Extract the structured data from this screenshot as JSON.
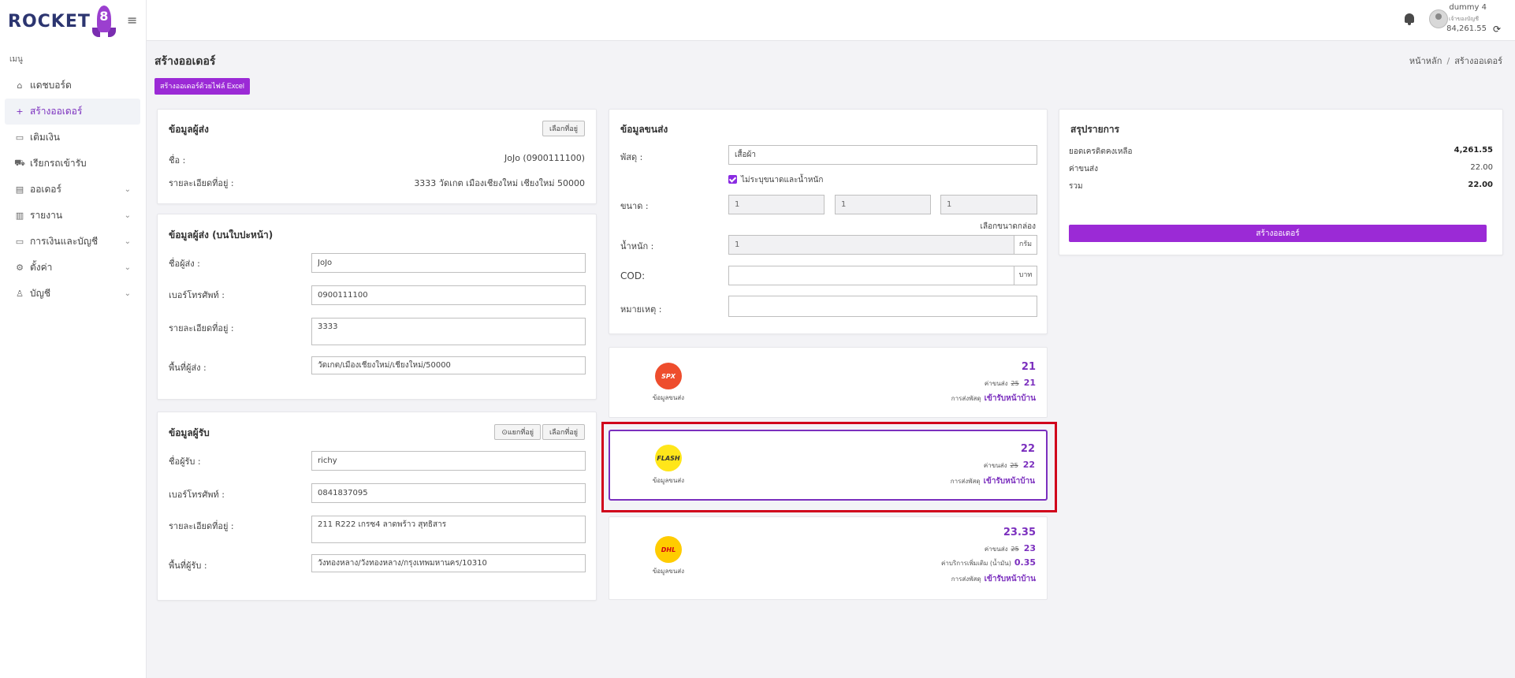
{
  "brand": {
    "logo_text": "ROCKET",
    "logo_digit": "8"
  },
  "sidebar": {
    "menu_title": "เมนู",
    "items": [
      {
        "label": "แดชบอร์ด",
        "icon": "home-icon",
        "glyph": "⌂"
      },
      {
        "label": "สร้างออเดอร์",
        "icon": "plus-icon",
        "glyph": "+"
      },
      {
        "label": "เติมเงิน",
        "icon": "money-icon",
        "glyph": "▭"
      },
      {
        "label": "เรียกรถเข้ารับ",
        "icon": "truck-icon",
        "glyph": "⛟"
      },
      {
        "label": "ออเดอร์",
        "icon": "order-icon",
        "glyph": "▤"
      },
      {
        "label": "รายงาน",
        "icon": "report-icon",
        "glyph": "▥"
      },
      {
        "label": "การเงินและบัญชี",
        "icon": "wallet-icon",
        "glyph": "▭"
      },
      {
        "label": "ตั้งค่า",
        "icon": "gear-icon",
        "glyph": "⚙"
      },
      {
        "label": "บัญชี",
        "icon": "user-icon",
        "glyph": "♙"
      }
    ]
  },
  "header": {
    "user_name": "dummy 4",
    "user_sub": "เจ้าของบัญชี",
    "credit": "84,261.55"
  },
  "page": {
    "title": "สร้างออเดอร์",
    "breadcrumb_home": "หน้าหลัก",
    "breadcrumb_sep": "/",
    "breadcrumb_current": "สร้างออเดอร์",
    "excel_button": "สร้างออเดอร์ด้วยไฟล์ Excel"
  },
  "sender": {
    "title": "ข้อมูลผู้ส่ง",
    "choose_btn": "เลือกที่อยู่",
    "name_label": "ชื่อ :",
    "name_value": "JoJo (0900111100)",
    "address_label": "รายละเอียดที่อยู่ :",
    "address_value": "3333 วัดเกต เมืองเชียงใหม่ เชียงใหม่ 50000"
  },
  "sender_label": {
    "title": "ข้อมูลผู้ส่ง (บนใบปะหน้า)",
    "name_label": "ชื่อผู้ส่ง :",
    "name_value": "JoJo",
    "phone_label": "เบอร์โทรศัพท์ :",
    "phone_value": "0900111100",
    "address_label": "รายละเอียดที่อยู่ :",
    "address_value": "3333",
    "area_label": "พื้นที่ผู้ส่ง :",
    "area_value": "วัดเกต/เมืองเชียงใหม่/เชียงใหม่/50000"
  },
  "receiver": {
    "title": "ข้อมูลผู้รับ",
    "split_btn": "แยกที่อยู่",
    "choose_btn": "เลือกที่อยู่",
    "name_label": "ชื่อผู้รับ :",
    "name_value": "richy",
    "phone_label": "เบอร์โทรศัพท์ :",
    "phone_value": "0841837095",
    "address_label": "รายละเอียดที่อยู่ :",
    "address_value": "211 R222 เกรซ4 ลาดพร้าว สุทธิสาร",
    "area_label": "พื้นที่ผู้รับ :",
    "area_value": "วังทองหลาง/วังทองหลาง/กรุงเทพมหานคร/10310"
  },
  "shipping": {
    "title": "ข้อมูลขนส่ง",
    "parcel_label": "พัสดุ :",
    "parcel_value": "เสื้อผ้า",
    "no_size_label": "ไม่ระบุขนาดและน้ำหนัก",
    "size_label": "ขนาด :",
    "size_w": "1",
    "size_l": "1",
    "size_h": "1",
    "choose_box": "เลือกขนาดกล่อง",
    "weight_label": "น้ำหนัก :",
    "weight_value": "1",
    "weight_unit": "กรัม",
    "cod_label": "COD:",
    "cod_value": "",
    "cod_unit": "บาท",
    "note_label": "หมายเหตุ :",
    "note_value": ""
  },
  "couriers": [
    {
      "name": "SPX",
      "logo_color": "#ee4d2d",
      "logo_text_color": "#ffffff",
      "caption": "ข้อมูลขนส่ง",
      "price": "21",
      "ship_label": "ค่าขนส่ง",
      "old_price": "25",
      "ship_price": "21",
      "pickup_label": "การส่งพัสดุ",
      "pickup_value": "เข้ารับหน้าบ้าน"
    },
    {
      "name": "FLASH",
      "logo_color": "#ffe61a",
      "logo_text_color": "#333333",
      "caption": "ข้อมูลขนส่ง",
      "price": "22",
      "ship_label": "ค่าขนส่ง",
      "old_price": "25",
      "ship_price": "22",
      "pickup_label": "การส่งพัสดุ",
      "pickup_value": "เข้ารับหน้าบ้าน"
    },
    {
      "name": "DHL",
      "logo_color": "#ffcc00",
      "logo_text_color": "#d40511",
      "caption": "ข้อมูลขนส่ง",
      "price": "23.35",
      "ship_label": "ค่าขนส่ง",
      "old_price": "25",
      "ship_price": "23",
      "extra_label": "ค่าบริการเพิ่มเติม (น้ำมัน)",
      "extra_value": "0.35",
      "pickup_label": "การส่งพัสดุ",
      "pickup_value": "เข้ารับหน้าบ้าน"
    }
  ],
  "summary": {
    "title": "สรุปรายการ",
    "credit_label": "ยอดเครดิตคงเหลือ",
    "credit_value": "4,261.55",
    "ship_label": "ค่าขนส่ง",
    "ship_value": "22.00",
    "total_label": "รวม",
    "total_value": "22.00",
    "create_button": "สร้างออเดอร์"
  },
  "colors": {
    "accent": "#9b2ad6",
    "highlight": "#d0021b"
  }
}
